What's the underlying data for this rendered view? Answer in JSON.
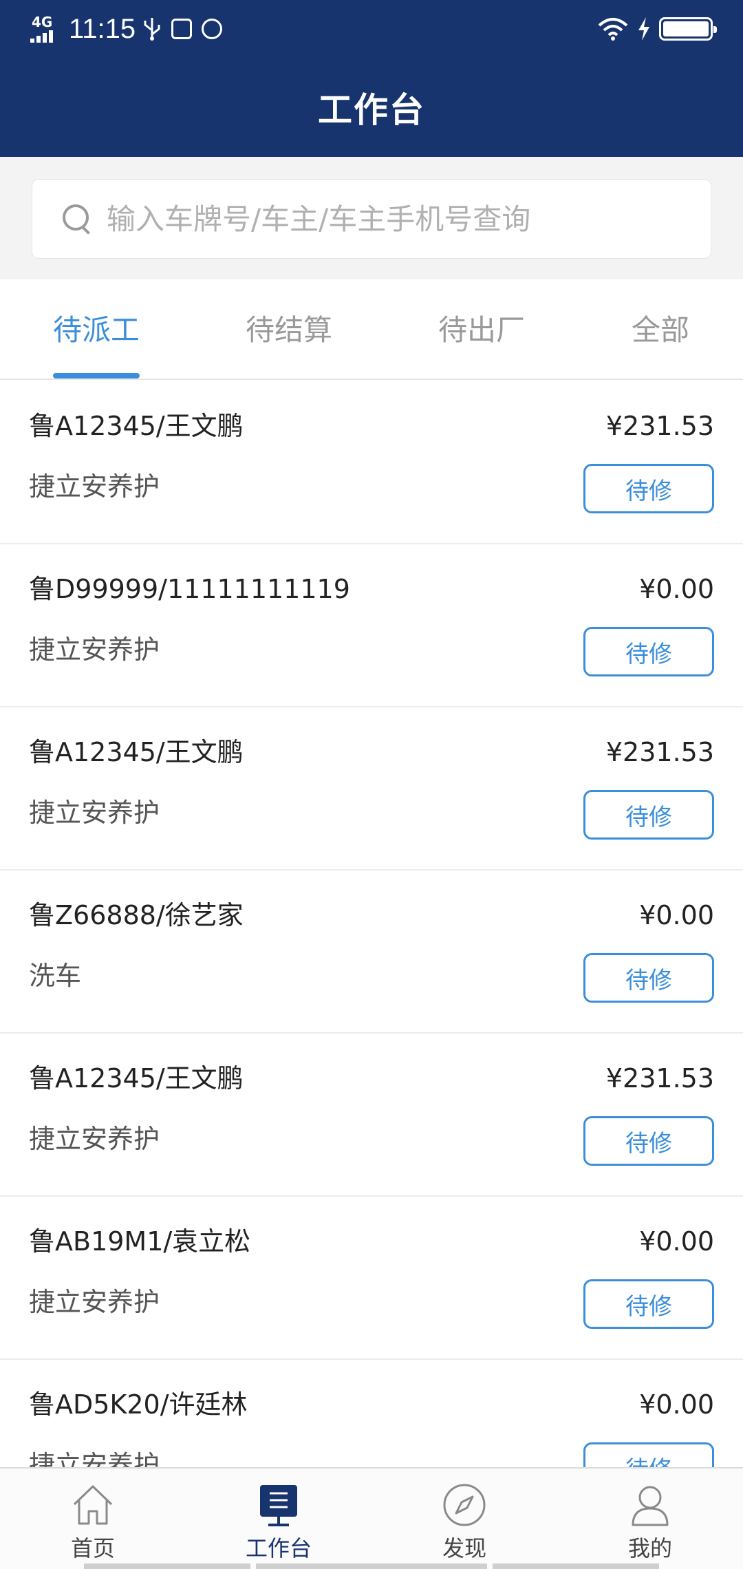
{
  "status_bar": {
    "network": "4G",
    "time": "11:15"
  },
  "header": {
    "title": "工作台"
  },
  "search": {
    "placeholder": "输入车牌号/车主/车主手机号查询",
    "value": ""
  },
  "tabs": [
    {
      "label": "待派工",
      "active": true
    },
    {
      "label": "待结算",
      "active": false
    },
    {
      "label": "待出厂",
      "active": false
    },
    {
      "label": "全部",
      "active": false
    }
  ],
  "orders": [
    {
      "plate_owner": "鲁A12345/王文鹏",
      "amount": "¥231.53",
      "service": "捷立安养护",
      "status": "待修"
    },
    {
      "plate_owner": "鲁D99999/11111111119",
      "amount": "¥0.00",
      "service": "捷立安养护",
      "status": "待修"
    },
    {
      "plate_owner": "鲁A12345/王文鹏",
      "amount": "¥231.53",
      "service": "捷立安养护",
      "status": "待修"
    },
    {
      "plate_owner": "鲁Z66888/徐艺家",
      "amount": "¥0.00",
      "service": "洗车",
      "status": "待修"
    },
    {
      "plate_owner": "鲁A12345/王文鹏",
      "amount": "¥231.53",
      "service": "捷立安养护",
      "status": "待修"
    },
    {
      "plate_owner": "鲁AB19M1/袁立松",
      "amount": "¥0.00",
      "service": "捷立安养护",
      "status": "待修"
    },
    {
      "plate_owner": "鲁AD5K20/许廷林",
      "amount": "¥0.00",
      "service": "捷立安养护",
      "status": "待修"
    }
  ],
  "bottom_nav": [
    {
      "label": "首页",
      "icon": "home-icon",
      "active": false
    },
    {
      "label": "工作台",
      "icon": "workbench-icon",
      "active": true
    },
    {
      "label": "发现",
      "icon": "compass-icon",
      "active": false
    },
    {
      "label": "我的",
      "icon": "user-icon",
      "active": false
    }
  ],
  "colors": {
    "header_bg": "#17346e",
    "accent": "#3a8edb",
    "active_nav": "#17346e"
  }
}
